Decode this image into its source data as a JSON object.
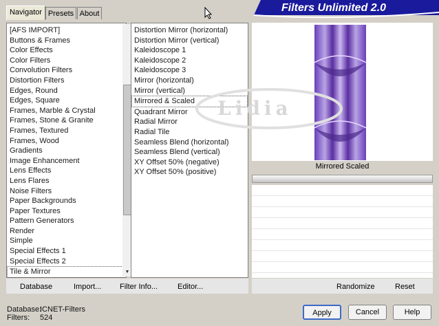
{
  "tabs": {
    "navigator": "Navigator",
    "presets": "Presets",
    "about": "About"
  },
  "title": "Filters Unlimited 2.0",
  "categories": [
    "[AFS IMPORT]",
    "Buttons & Frames",
    "Color Effects",
    "Color Filters",
    "Convolution Filters",
    "Distortion Filters",
    "Edges, Round",
    "Edges, Square",
    "Frames, Marble & Crystal",
    "Frames, Stone & Granite",
    "Frames, Textured",
    "Frames, Wood",
    "Gradients",
    "Image Enhancement",
    "Lens Effects",
    "Lens Flares",
    "Noise Filters",
    "Paper Backgrounds",
    "Paper Textures",
    "Pattern Generators",
    "Render",
    "Simple",
    "Special Effects 1",
    "Special Effects 2",
    "Tile & Mirror"
  ],
  "filters": [
    "Distortion Mirror (horizontal)",
    "Distortion Mirror (vertical)",
    "Kaleidoscope 1",
    "Kaleidoscope 2",
    "Kaleidoscope 3",
    "Mirror (horizontal)",
    "Mirror (vertical)",
    "Mirrored & Scaled",
    "Quadrant Mirror",
    "Radial Mirror",
    "Radial Tile",
    "Seamless Blend (horizontal)",
    "Seamless Blend (vertical)",
    "XY Offset 50% (negative)",
    "XY Offset 50% (positive)"
  ],
  "preview_label": "Mirrored  Scaled",
  "watermark": "Lidia",
  "buttons": {
    "database": "Database",
    "import": "Import...",
    "filter_info": "Filter Info...",
    "editor": "Editor...",
    "randomize": "Randomize",
    "reset": "Reset",
    "apply": "Apply",
    "cancel": "Cancel",
    "help": "Help"
  },
  "info": {
    "database_label": "Database:",
    "database_value": "ICNET-Filters",
    "filters_label": "Filters:",
    "filters_value": "524"
  },
  "colors": {
    "banner": "#1a1a9c",
    "preview_dark": "#4b2a8c",
    "preview_light": "#b9a4e6"
  }
}
